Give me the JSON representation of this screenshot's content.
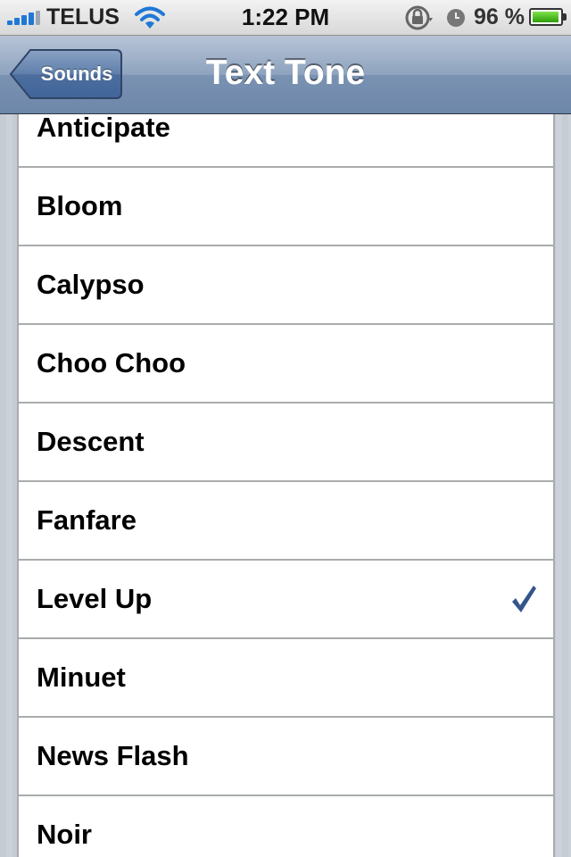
{
  "status_bar": {
    "carrier": "TELUS",
    "time": "1:22 PM",
    "battery_percent_label": "96 %",
    "battery_level": 0.96,
    "signal_icon": "signal-bars-icon",
    "wifi_icon": "wifi-icon",
    "rotation_lock_icon": "rotation-lock-icon",
    "alarm_icon": "alarm-clock-icon",
    "battery_icon": "battery-icon"
  },
  "nav": {
    "back_label": "Sounds",
    "title": "Text Tone"
  },
  "tones": [
    {
      "label": "Anticipate",
      "selected": false
    },
    {
      "label": "Bloom",
      "selected": false
    },
    {
      "label": "Calypso",
      "selected": false
    },
    {
      "label": "Choo Choo",
      "selected": false
    },
    {
      "label": "Descent",
      "selected": false
    },
    {
      "label": "Fanfare",
      "selected": false
    },
    {
      "label": "Level Up",
      "selected": true
    },
    {
      "label": "Minuet",
      "selected": false
    },
    {
      "label": "News Flash",
      "selected": false
    },
    {
      "label": "Noir",
      "selected": false
    }
  ],
  "colors": {
    "checkmark": "#34558b",
    "nav_bar": "#6d87a9",
    "signal": "#1f78d6",
    "battery_fill": "#2e9d0a"
  }
}
